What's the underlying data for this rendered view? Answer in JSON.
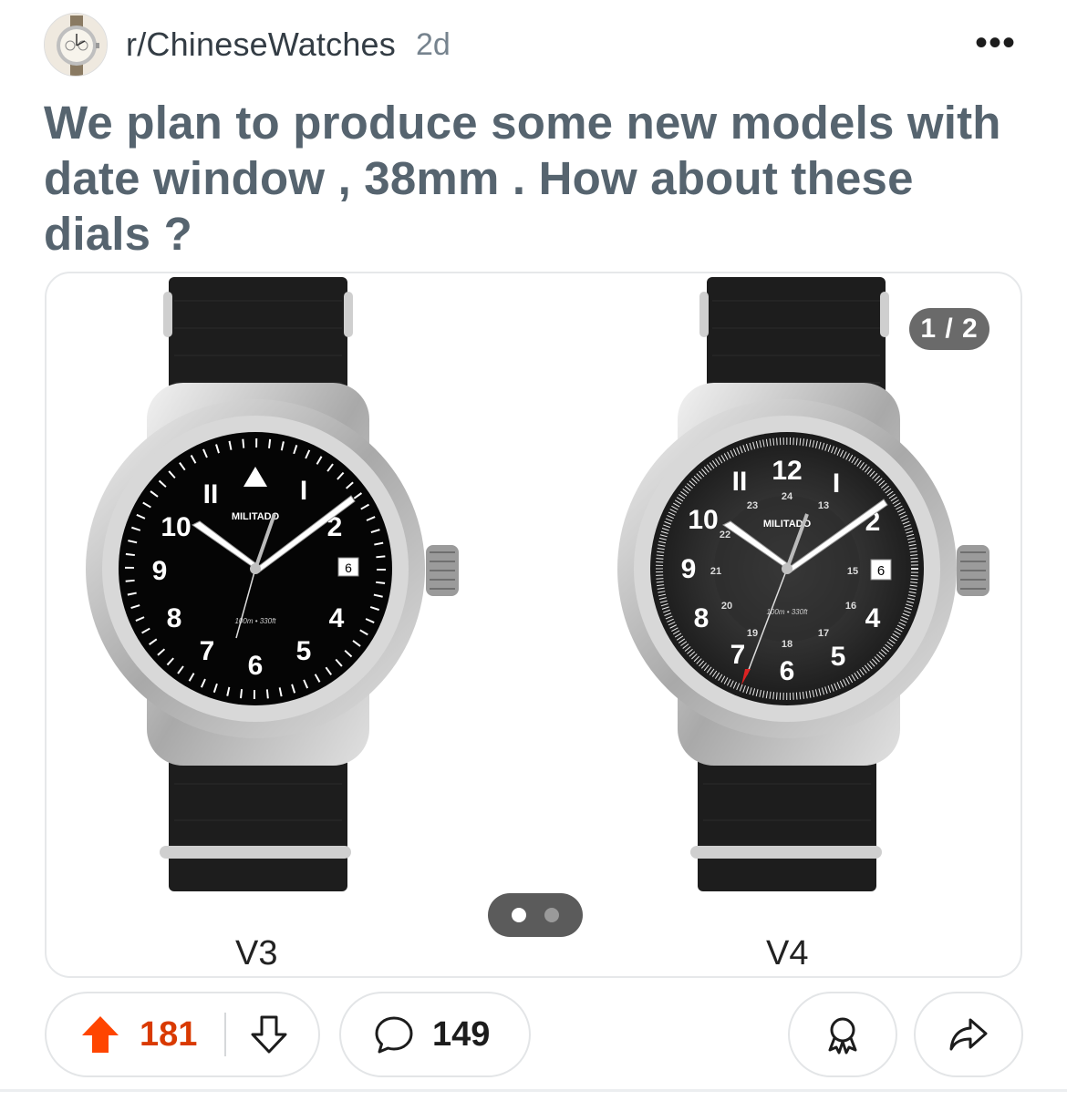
{
  "post": {
    "subreddit": "r/ChineseWatches",
    "age": "2d",
    "more_icon": "more-horizontal-icon",
    "title": "We plan to produce some new models with date window , 38mm . How about these dials ?"
  },
  "gallery": {
    "counter": "1 / 2",
    "current_index": 1,
    "total": 2,
    "images": [
      {
        "caption": "V3",
        "brand": "MILITADO",
        "depth_rating": "100m • 330ft",
        "date": "6",
        "hour_numerals": [
          "10",
          "9",
          "8",
          "7",
          "6",
          "5",
          "4",
          "2",
          "II",
          "I"
        ]
      },
      {
        "caption": "V4",
        "brand": "MILITADO",
        "depth_rating": "100m • 330ft",
        "date": "6",
        "hour_numerals": [
          "12",
          "10",
          "9",
          "8",
          "7",
          "6",
          "5",
          "4",
          "2",
          "II",
          "I"
        ],
        "inner_numerals": [
          "24",
          "23",
          "13",
          "22",
          "21",
          "20",
          "19",
          "18",
          "17",
          "16",
          "15"
        ]
      }
    ]
  },
  "actions": {
    "upvotes": "181",
    "comments": "149",
    "upvote_color": "#d93a00",
    "icons": [
      "upvote-icon",
      "downvote-icon",
      "comment-icon",
      "award-icon",
      "share-icon"
    ]
  }
}
